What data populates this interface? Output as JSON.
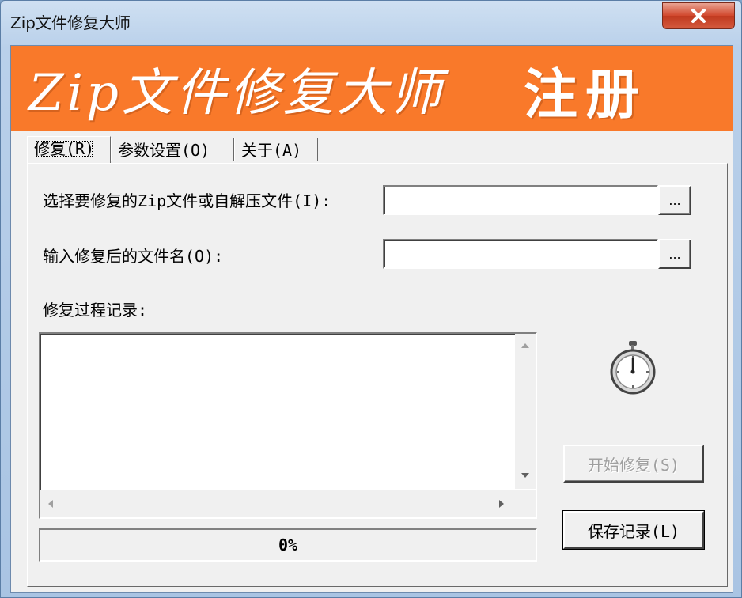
{
  "window": {
    "title": "Zip文件修复大师",
    "close_label": "✕"
  },
  "banner": {
    "title": "Zip文件修复大师",
    "register": "注册"
  },
  "tabs": [
    {
      "label": "修复(R)",
      "active": true
    },
    {
      "label": "参数设置(O)",
      "active": false
    },
    {
      "label": "关于(A)",
      "active": false
    }
  ],
  "repair": {
    "source_label": "选择要修复的Zip文件或自解压文件(I):",
    "source_value": "",
    "output_label": "输入修复后的文件名(O):",
    "output_value": "",
    "browse_label": "...",
    "log_label": "修复过程记录:",
    "log_text": "",
    "progress_text": "0%",
    "progress_value": 0,
    "start_button": "开始修复(S)",
    "save_button": "保存记录(L)",
    "stopwatch_icon": "stopwatch-icon"
  },
  "colors": {
    "banner": "#f9792a",
    "close": "#c0391f"
  }
}
